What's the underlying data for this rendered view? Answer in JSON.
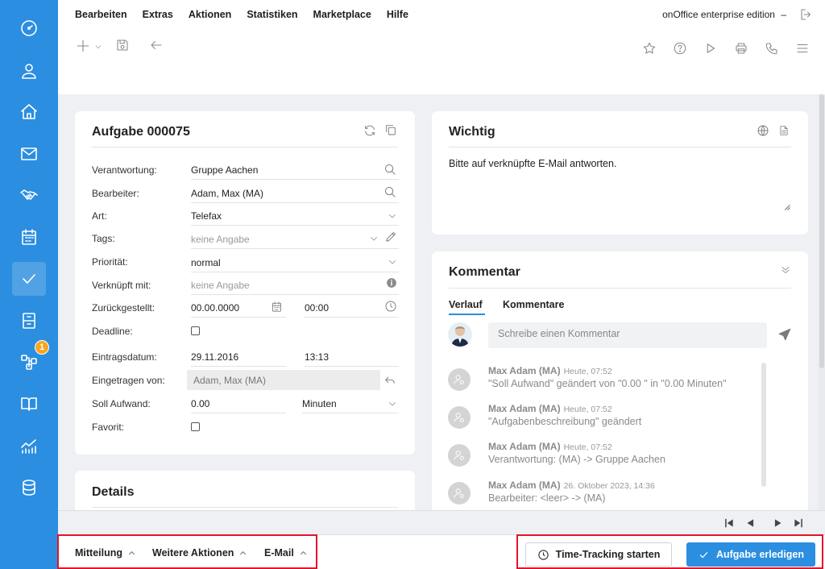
{
  "menu": [
    "Bearbeiten",
    "Extras",
    "Aktionen",
    "Statistiken",
    "Marketplace",
    "Hilfe"
  ],
  "edition": "onOffice enterprise edition",
  "edition_sep": "–",
  "task": {
    "title": "Aufgabe 000075",
    "fields": {
      "verantwortung_label": "Verantwortung:",
      "verantwortung_value": "Gruppe Aachen",
      "bearbeiter_label": "Bearbeiter:",
      "bearbeiter_value": "Adam, Max (MA)",
      "art_label": "Art:",
      "art_value": "Telefax",
      "tags_label": "Tags:",
      "tags_placeholder": "keine Angabe",
      "prioritaet_label": "Priorität:",
      "prioritaet_value": "normal",
      "verknuepft_label": "Verknüpft mit:",
      "verknuepft_placeholder": "keine Angabe",
      "zurueck_label": "Zurückgestellt:",
      "zurueck_date": "00.00.0000",
      "zurueck_time": "00:00",
      "deadline_label": "Deadline:",
      "eintrag_label": "Eintragsdatum:",
      "eintrag_date": "29.11.2016",
      "eintrag_time": "13:13",
      "eingetragen_label": "Eingetragen von:",
      "eingetragen_value": "Adam, Max (MA)",
      "soll_label": "Soll Aufwand:",
      "soll_value": "0.00",
      "soll_unit": "Minuten",
      "favorit_label": "Favorit:"
    }
  },
  "details": {
    "title": "Details"
  },
  "wichtig": {
    "title": "Wichtig",
    "text": "Bitte auf verknüpfte E-Mail antworten."
  },
  "kommentar": {
    "title": "Kommentar",
    "tabs": [
      "Verlauf",
      "Kommentare"
    ],
    "input_placeholder": "Schreibe einen Kommentar",
    "entries": [
      {
        "name": "Max Adam (MA)",
        "time": "Heute, 07:52",
        "text": "\"Soll Aufwand\" geändert von \"0.00 \" in \"0.00 Minuten\""
      },
      {
        "name": "Max Adam (MA)",
        "time": "Heute, 07:52",
        "text": "\"Aufgabenbeschreibung\" geändert"
      },
      {
        "name": "Max Adam (MA)",
        "time": "Heute, 07:52",
        "text": "Verantwortung: (MA) -> Gruppe Aachen"
      },
      {
        "name": "Max Adam (MA)",
        "time": "26. Oktober 2023, 14:36",
        "text": "Bearbeiter: <leer> -> (MA)"
      }
    ]
  },
  "sidebar_badge": "1",
  "bottom_actions": [
    "Mitteilung",
    "Weitere Aktionen",
    "E-Mail"
  ],
  "buttons": {
    "time_tracking": "Time-Tracking starten",
    "done": "Aufgabe erledigen"
  },
  "colors": {
    "accent": "#2b8ee0",
    "highlight": "#e4142a",
    "badge": "#f6a623"
  }
}
